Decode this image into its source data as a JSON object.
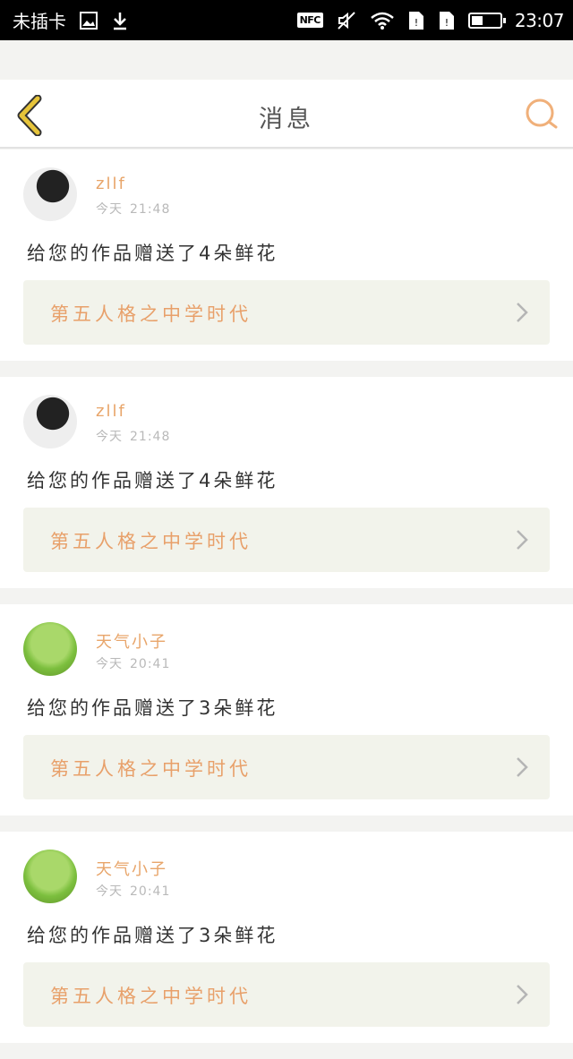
{
  "status_bar": {
    "carrier": "未插卡",
    "nfc": "NFC",
    "time": "23:07",
    "battery_level": 0.35
  },
  "header": {
    "title": "消息"
  },
  "messages": [
    {
      "user": "zllf",
      "day": "今天",
      "time": "21:48",
      "text": "给您的作品赠送了4朵鲜花",
      "work_title": "第五人格之中学时代",
      "avatar": "bw-portrait"
    },
    {
      "user": "zllf",
      "day": "今天",
      "time": "21:48",
      "text": "给您的作品赠送了4朵鲜花",
      "work_title": "第五人格之中学时代",
      "avatar": "bw-portrait"
    },
    {
      "user": "天气小子",
      "day": "今天",
      "time": "20:41",
      "text": "给您的作品赠送了3朵鲜花",
      "work_title": "第五人格之中学时代",
      "avatar": "green-sprout"
    },
    {
      "user": "天气小子",
      "day": "今天",
      "time": "20:41",
      "text": "给您的作品赠送了3朵鲜花",
      "work_title": "第五人格之中学时代",
      "avatar": "green-sprout"
    }
  ],
  "colors": {
    "accent": "#e8a06a",
    "back_icon": "#e6c43a",
    "search_icon": "#f0b07a"
  }
}
